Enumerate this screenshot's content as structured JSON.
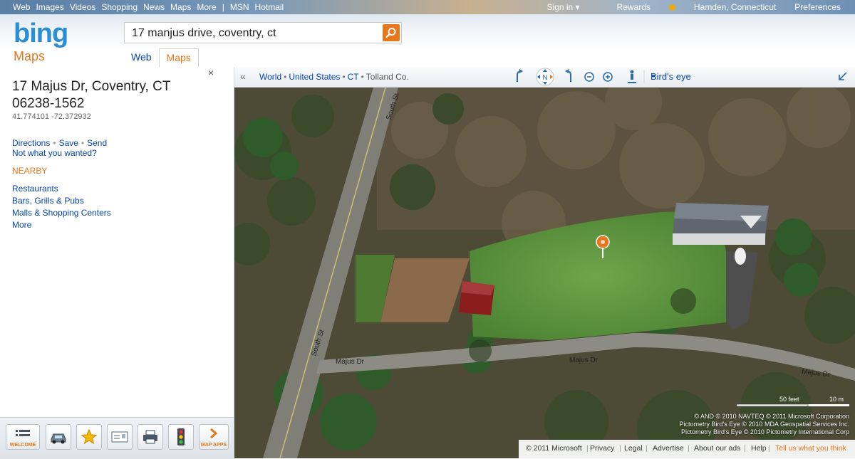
{
  "topnav": {
    "links": [
      "Web",
      "Images",
      "Videos",
      "Shopping",
      "News",
      "Maps",
      "More",
      "|",
      "MSN",
      "Hotmail"
    ],
    "signin": "Sign in ▾",
    "rewards": "Rewards",
    "location": "Hamden, Connecticut",
    "preferences": "Preferences"
  },
  "header": {
    "logo": "bing",
    "product": "Maps",
    "search_value": "17 manjus drive, coventry, ct",
    "tabs": [
      {
        "label": "Web",
        "active": false
      },
      {
        "label": "Maps",
        "active": true
      }
    ]
  },
  "panel": {
    "close": "×",
    "address_line1": "17 Majus Dr, Coventry, CT",
    "address_line2": "06238-1562",
    "coordinates": "41.774101 -72.372932",
    "actions": {
      "directions": "Directions",
      "save": "Save",
      "send": "Send"
    },
    "not_what": "Not what you wanted?",
    "nearby_heading": "NEARBY",
    "nearby": [
      "Restaurants",
      "Bars, Grills & Pubs",
      "Malls & Shopping Centers",
      "More"
    ]
  },
  "toolbar": {
    "buttons": [
      {
        "name": "welcome",
        "label": "WELCOME"
      },
      {
        "name": "car",
        "label": ""
      },
      {
        "name": "favorites",
        "label": ""
      },
      {
        "name": "card",
        "label": ""
      },
      {
        "name": "print",
        "label": ""
      },
      {
        "name": "traffic",
        "label": ""
      },
      {
        "name": "map-apps",
        "label": "MAP APPS"
      }
    ]
  },
  "mapbar": {
    "breadcrumb": [
      "World",
      "United States",
      "CT",
      "Tolland Co."
    ],
    "north": "N",
    "view_mode": "Bird's eye"
  },
  "map": {
    "roads": {
      "south_st_upper": "South St",
      "south_st_lower": "South St",
      "majus_left": "Majus Dr",
      "majus_mid": "Majus Dr",
      "majus_right": "Majus Dr"
    },
    "scale_feet": "50 feet",
    "scale_m": "10 m",
    "attribution": [
      "© AND © 2010 NAVTEQ © 2011 Microsoft Corporation",
      "Pictometry Bird's Eye © 2010 MDA Geospatial Services Inc.",
      "Pictometry Bird's Eye © 2010 Pictometry International Corp"
    ]
  },
  "footer": {
    "copyright": "© 2011 Microsoft",
    "privacy": "Privacy",
    "legal": "Legal",
    "advertise": "Advertise",
    "about_ads": "About our ads",
    "help": "Help",
    "tell_us": "Tell us what you think"
  },
  "colors": {
    "accent": "#e8761b",
    "link": "#0645ad",
    "bing_blue": "#2b8fd7"
  }
}
